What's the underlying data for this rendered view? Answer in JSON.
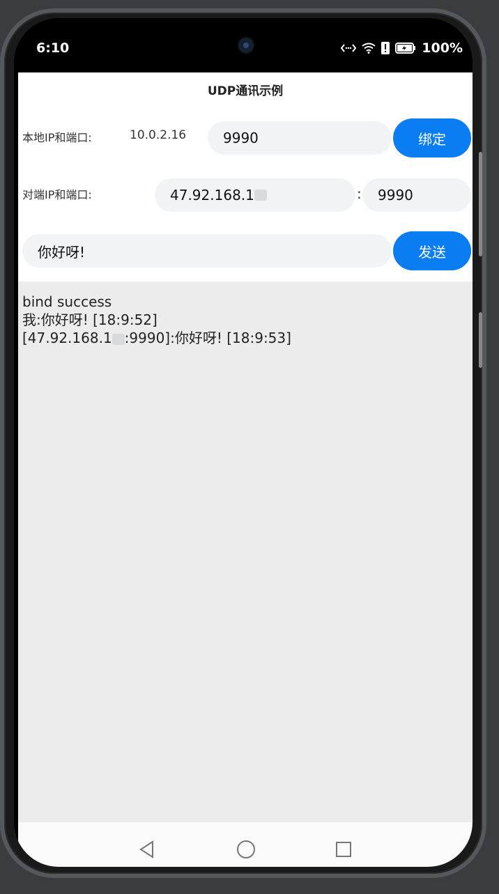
{
  "status_bar": {
    "time": "6:10",
    "battery": "100%"
  },
  "app": {
    "title": "UDP通讯示例"
  },
  "local": {
    "label": "本地IP和端口:",
    "ip": "10.0.2.16",
    "port": "9990",
    "bind_label": "绑定"
  },
  "remote": {
    "label": "对端IP和端口:",
    "ip_visible": "47.92.168.1",
    "separator": ":",
    "port": "9990"
  },
  "message": {
    "value": "你好呀!",
    "send_label": "发送"
  },
  "log": {
    "lines": [
      "bind success",
      "我:你好呀!  [18:9:52]",
      "[47.92.168.1",
      ":9990]:你好呀!  [18:9:53]"
    ]
  },
  "nav_bar": {
    "icons": [
      "back-icon",
      "home-icon",
      "recents-icon"
    ]
  }
}
